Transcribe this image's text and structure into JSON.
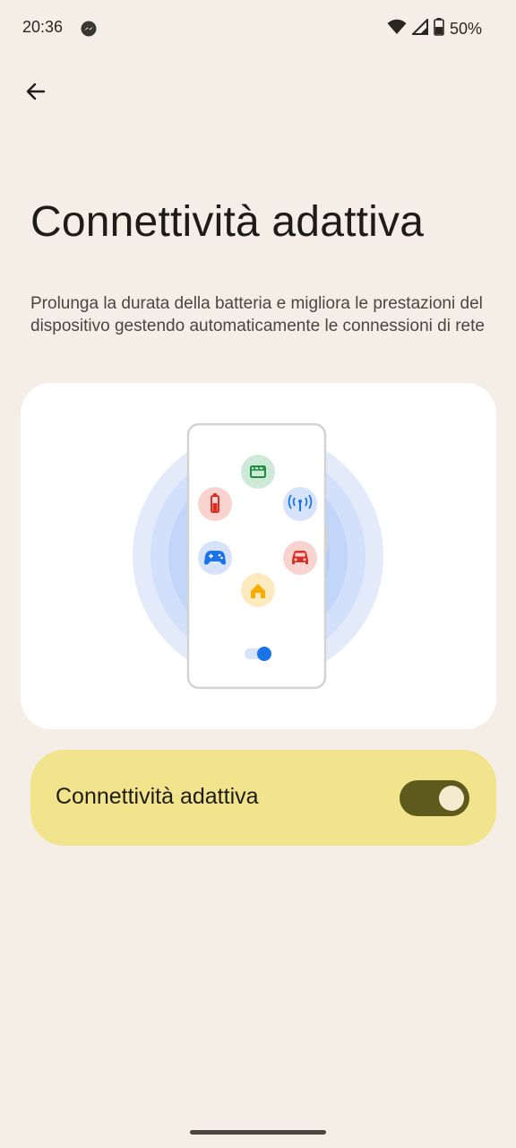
{
  "status_bar": {
    "time": "20:36",
    "battery_percent": "50%",
    "icons": [
      "messenger-icon",
      "wifi-icon",
      "cell-signal-icon",
      "battery-icon"
    ]
  },
  "navigation": {
    "back_icon": "arrow-back-icon"
  },
  "page": {
    "title": "Connettività adattiva",
    "description": "Prolunga la durata della batteria e migliora le prestazioni del dispositivo gestendo automaticamente le connessioni di rete"
  },
  "illustration": {
    "app_icons": [
      "video-icon",
      "battery-icon",
      "antenna-icon",
      "gamepad-icon",
      "car-icon",
      "home-icon"
    ],
    "mini_toggle_state": "on"
  },
  "toggle": {
    "label": "Connettività adattiva",
    "state": "on"
  },
  "colors": {
    "background": "#f4eee6",
    "card_accent": "#f1e48c",
    "switch_track": "#5e5a1e",
    "illustration_blue": "#1a73e8"
  }
}
